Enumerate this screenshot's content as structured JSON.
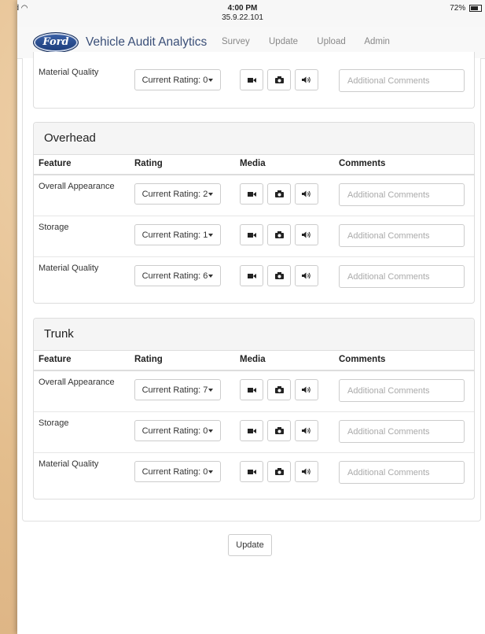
{
  "status": {
    "device": "iPad",
    "time": "4:00 PM",
    "address": "35.9.22.101",
    "battery": "72%"
  },
  "nav": {
    "logo": "Ford",
    "brand": "Vehicle Audit Analytics",
    "links": [
      "Survey",
      "Update",
      "Upload",
      "Admin"
    ]
  },
  "table_headers": {
    "feature": "Feature",
    "rating": "Rating",
    "media": "Media",
    "comments": "Comments"
  },
  "comment_placeholder": "Additional Comments",
  "top_partial": {
    "feature": "Material Quality",
    "rating": "Current Rating: 0"
  },
  "sections": [
    {
      "title": "Overhead",
      "rows": [
        {
          "feature": "Overall Appearance",
          "rating": "Current Rating: 2"
        },
        {
          "feature": "Storage",
          "rating": "Current Rating: 1"
        },
        {
          "feature": "Material Quality",
          "rating": "Current Rating: 6"
        }
      ]
    },
    {
      "title": "Trunk",
      "rows": [
        {
          "feature": "Overall Appearance",
          "rating": "Current Rating: 7"
        },
        {
          "feature": "Storage",
          "rating": "Current Rating: 0"
        },
        {
          "feature": "Material Quality",
          "rating": "Current Rating: 0"
        }
      ]
    }
  ],
  "update_label": "Update"
}
